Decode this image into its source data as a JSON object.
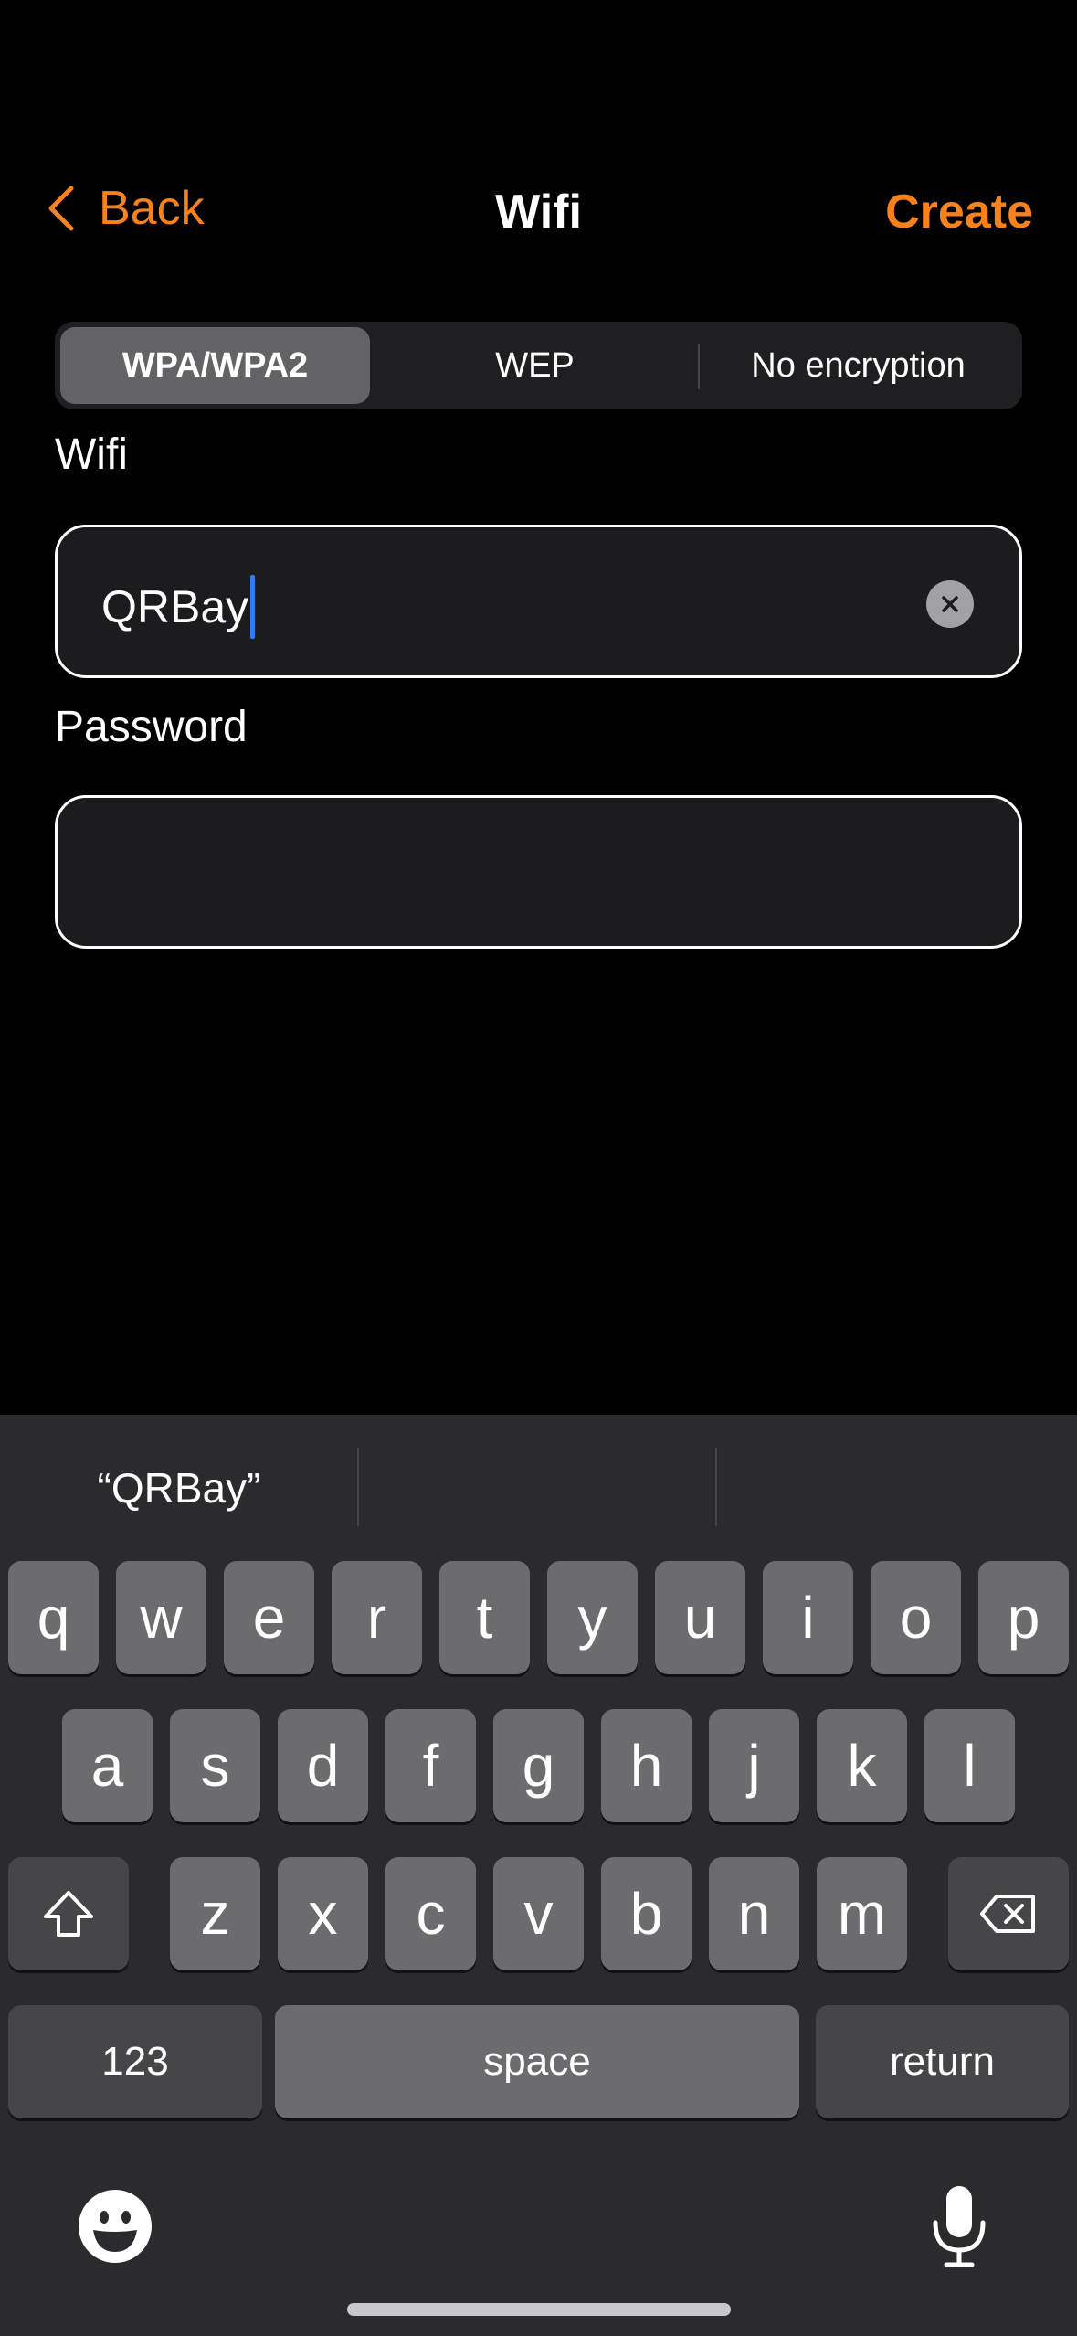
{
  "nav": {
    "back_label": "Back",
    "title": "Wifi",
    "create_label": "Create",
    "accent_color": "#f7821b"
  },
  "encryption": {
    "options": [
      "WPA/WPA2",
      "WEP",
      "No encryption"
    ],
    "selected": "WPA/WPA2"
  },
  "form": {
    "wifi_label": "Wifi",
    "wifi_value": "QRBay",
    "password_label": "Password",
    "password_value": ""
  },
  "keyboard": {
    "suggestions": [
      "“QRBay”",
      "",
      ""
    ],
    "row1": [
      "q",
      "w",
      "e",
      "r",
      "t",
      "y",
      "u",
      "i",
      "o",
      "p"
    ],
    "row2": [
      "a",
      "s",
      "d",
      "f",
      "g",
      "h",
      "j",
      "k",
      "l"
    ],
    "row3": [
      "z",
      "x",
      "c",
      "v",
      "b",
      "n",
      "m"
    ],
    "numbers_label": "123",
    "space_label": "space",
    "return_label": "return",
    "icons": [
      "shift-icon",
      "delete-icon",
      "emoji-icon",
      "microphone-icon"
    ]
  }
}
